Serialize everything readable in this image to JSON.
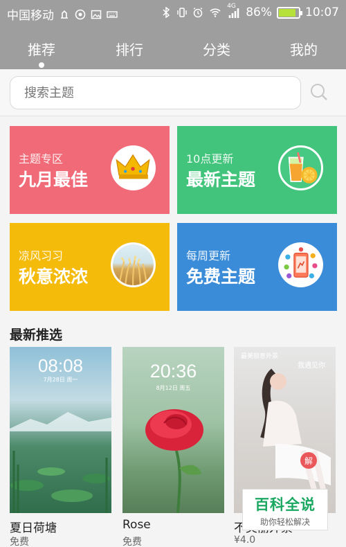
{
  "status": {
    "carrier": "中国移动",
    "network_label": "4G",
    "battery": "86%",
    "battery_level": 0.86,
    "time": "10:07"
  },
  "nav": {
    "tabs": [
      {
        "label": "推荐",
        "active": true
      },
      {
        "label": "排行"
      },
      {
        "label": "分类"
      },
      {
        "label": "我的"
      }
    ]
  },
  "search": {
    "placeholder": "搜索主题",
    "icon": "search-icon"
  },
  "tiles": [
    {
      "sub": "主题专区",
      "title": "九月最佳",
      "color": "#f06a78",
      "icon": "crown-icon"
    },
    {
      "sub": "10点更新",
      "title": "最新主题",
      "color": "#43c47c",
      "icon": "juice-icon"
    },
    {
      "sub": "凉风习习",
      "title": "秋意浓浓",
      "color": "#f5bb0b",
      "icon": "wheat-icon"
    },
    {
      "sub": "每周更新",
      "title": "免费主题",
      "color": "#3a8bd8",
      "icon": "phone-apps-icon"
    }
  ],
  "section_title": "最新推选",
  "themes": [
    {
      "name": "夏日荷塘",
      "price": "免费",
      "clock": "08:08",
      "date": "7月28日 周一"
    },
    {
      "name": "Rose",
      "price": "免费",
      "clock": "20:36",
      "date": "8月12日 周五"
    },
    {
      "name": "不美丽外景",
      "price": "¥4.0",
      "header": "最美丽意外景",
      "sub": "我遇见你"
    }
  ],
  "watermark": {
    "title": "百科全说",
    "subtitle": "助你轻松解决"
  }
}
